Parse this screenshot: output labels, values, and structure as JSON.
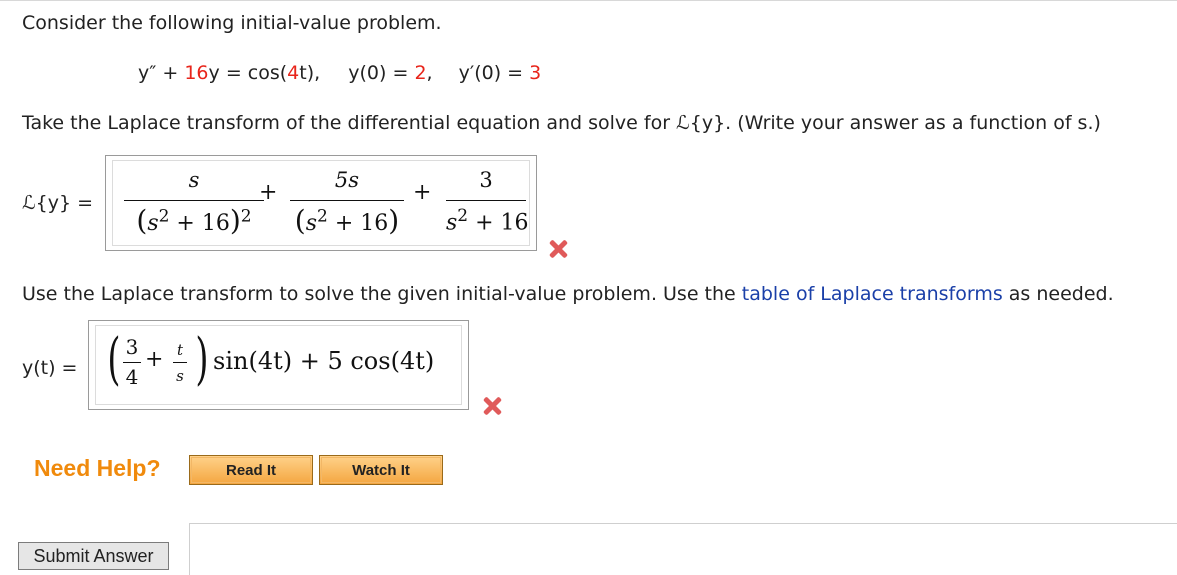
{
  "problem": {
    "intro": "Consider the following initial-value problem.",
    "eq": {
      "lhs_a": "y″ + ",
      "coef": "16",
      "lhs_b": "y = cos(",
      "freq": "4",
      "lhs_c": "t),",
      "ic1_a": "y(0) = ",
      "ic1_val": "2",
      "ic1_b": ",",
      "ic2_a": "y′(0) = ",
      "ic2_val": "3"
    },
    "instruction1": "Take the Laplace transform of the differential equation and solve for ℒ{y}. (Write your answer as a function of s.)",
    "instruction2_a": "Use the Laplace transform to solve the given initial-value problem. Use the ",
    "instruction2_link": "table of Laplace transforms",
    "instruction2_b": " as needed."
  },
  "answer1": {
    "label": "ℒ{y} =",
    "t1": {
      "num": "s",
      "den_open": "(",
      "den_s": "s",
      "den_sup": "2",
      "den_mid": " + 16",
      "den_close": ")",
      "den_pow": "2"
    },
    "plus1": "+",
    "t2": {
      "num": "5s",
      "den_open": "(",
      "den_s": "s",
      "den_sup": "2",
      "den_mid": " + 16",
      "den_close": ")"
    },
    "plus2": "+",
    "t3": {
      "num": "3",
      "den_s": "s",
      "den_sup": "2",
      "den_mid": " + 16"
    }
  },
  "answer2": {
    "label": "y(t) =",
    "lparen": "(",
    "f1": {
      "num": "3",
      "den": "4"
    },
    "plus": "+",
    "f2": {
      "num": "t",
      "den": "s"
    },
    "rparen": ")",
    "sin": "sin",
    "sin_arg": "(4t)",
    "mid": " + 5 cos",
    "cos_arg": "(4t)"
  },
  "help": {
    "title": "Need Help?",
    "read_it": "Read It",
    "watch_it": "Watch It"
  },
  "submit": "Submit Answer",
  "colors": {
    "red": "#e8251b",
    "link": "#1a3fa8",
    "help": "#f08a0c"
  }
}
